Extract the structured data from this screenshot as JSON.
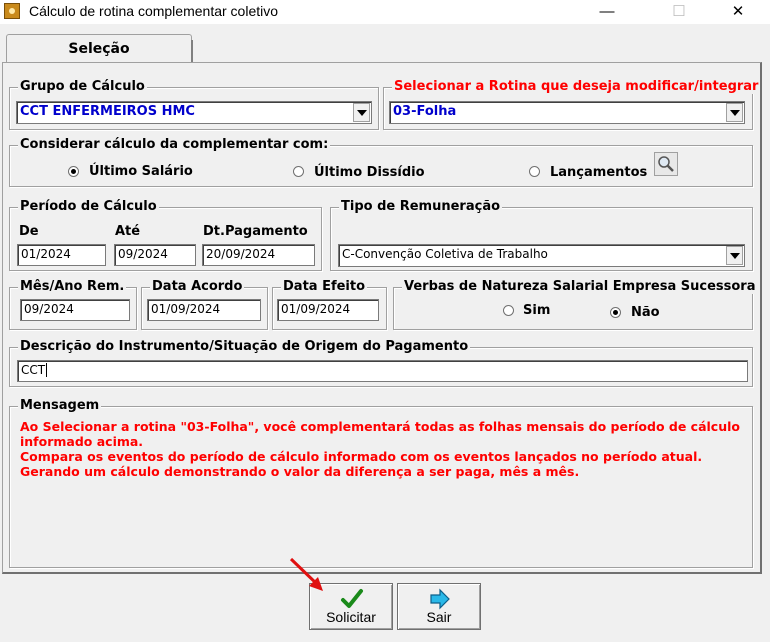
{
  "window": {
    "title": "Cálculo de rotina complementar coletivo",
    "minimize": "—",
    "maximize": "☐",
    "close": "✕"
  },
  "tab": {
    "label": "Seleção"
  },
  "grupo": {
    "legend": "Grupo de Cálculo",
    "value": "CCT ENFERMEIROS HMC"
  },
  "rotina": {
    "legend": "Selecionar a Rotina que deseja modificar/integrar",
    "value": "03-Folha"
  },
  "considerar": {
    "legend": "Considerar cálculo da complementar com:",
    "options": [
      "Último Salário",
      "Último Dissídio",
      "Lançamentos"
    ],
    "selected": "Último Salário"
  },
  "periodo": {
    "legend": "Período de Cálculo",
    "de_label": "De",
    "de_value": "01/2024",
    "ate_label": "Até",
    "ate_value": "09/2024",
    "dtpag_label": "Dt.Pagamento",
    "dtpag_value": "20/09/2024"
  },
  "remuneracao": {
    "legend": "Tipo de Remuneração",
    "value": "C-Convenção Coletiva de Trabalho"
  },
  "mesano": {
    "legend": "Mês/Ano Rem.",
    "value": "09/2024"
  },
  "acordo": {
    "legend": "Data Acordo",
    "value": "01/09/2024"
  },
  "efeito": {
    "legend": "Data Efeito",
    "value": "01/09/2024"
  },
  "verbas": {
    "legend": "Verbas de Natureza Salarial Empresa Sucessora",
    "sim": "Sim",
    "nao": "Não",
    "selected": "Não"
  },
  "descricao": {
    "legend": "Descrição do Instrumento/Situação de Origem do Pagamento",
    "value": "CCT"
  },
  "mensagem": {
    "legend": "Mensagem",
    "text": "Ao Selecionar a rotina \"03-Folha\", você complementará todas as folhas mensais do período de cálculo\ninformado acima.\nCompara os eventos do período de cálculo informado com os eventos lançados no período atual.\nGerando um cálculo demonstrando o valor da diferença a ser paga, mês a mês."
  },
  "buttons": {
    "solicitar": "Solicitar",
    "sair": "Sair"
  },
  "colors": {
    "accent_red": "#ff0000",
    "value_blue": "#0000cc"
  }
}
